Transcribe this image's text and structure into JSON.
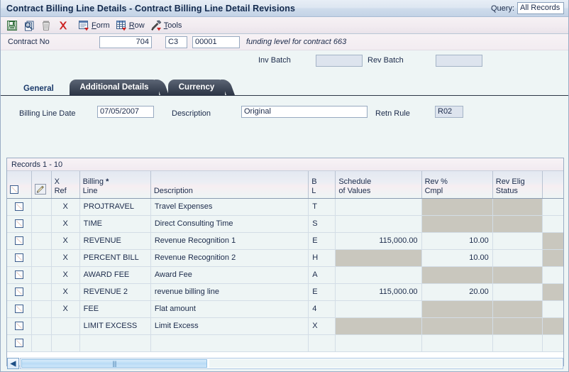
{
  "window": {
    "title": "Contract Billing Line Details - Contract Billing Line Detail Revisions",
    "query_label": "Query:",
    "query_value": "All Records"
  },
  "toolbar": {
    "items": [
      {
        "icon": "save-icon",
        "label": ""
      },
      {
        "icon": "find-icon",
        "label": ""
      },
      {
        "icon": "delete-icon",
        "label": ""
      },
      {
        "icon": "cancel-icon",
        "label": ""
      },
      {
        "icon": "form-icon",
        "label": "Form",
        "accel": "F"
      },
      {
        "icon": "row-icon",
        "label": "Row",
        "accel": "R"
      },
      {
        "icon": "tools-icon",
        "label": "Tools",
        "accel": "T"
      }
    ],
    "form_label_pre": "",
    "form_label_key": "F",
    "form_label_post": "orm",
    "row_label_pre": "",
    "row_label_key": "R",
    "row_label_post": "ow",
    "tools_label_pre": "",
    "tools_label_key": "T",
    "tools_label_post": "ools"
  },
  "header": {
    "contract_no_label": "Contract No",
    "contract_no": "704",
    "contract_type": "C3",
    "contract_seq": "00001",
    "contract_note": "funding level for contract 663",
    "inv_batch_label": "Inv Batch",
    "inv_batch": "",
    "rev_batch_label": "Rev Batch",
    "rev_batch": ""
  },
  "tabs": [
    {
      "label": "General",
      "active": true
    },
    {
      "label": "Additional Details",
      "active": false
    },
    {
      "label": "Currency",
      "active": false
    }
  ],
  "detail": {
    "billing_line_date_label": "Billing Line Date",
    "billing_line_date": "07/05/2007",
    "description_label": "Description",
    "description": "Original",
    "retn_rule_label": "Retn Rule",
    "retn_rule": "R02"
  },
  "grid": {
    "records_text": "Records  1 - 10",
    "columns": [
      {
        "name": "select",
        "l1": "",
        "l2": "",
        "required": false
      },
      {
        "name": "pencil",
        "l1": "",
        "l2": "",
        "required": false
      },
      {
        "name": "x-ref",
        "l1": "X",
        "l2": "Ref",
        "required": false
      },
      {
        "name": "billing-line",
        "l1": "Billing",
        "l2": "Line",
        "required": true
      },
      {
        "name": "description",
        "l1": "",
        "l2": "Description",
        "required": false
      },
      {
        "name": "b-l",
        "l1": "B",
        "l2": "L",
        "required": false
      },
      {
        "name": "schedule-of-values",
        "l1": "Schedule",
        "l2": "of Values",
        "required": false
      },
      {
        "name": "rev-pct-cmpl",
        "l1": "Rev %",
        "l2": "Cmpl",
        "required": false
      },
      {
        "name": "rev-elig-status",
        "l1": "Rev Elig",
        "l2": "Status",
        "required": false
      },
      {
        "name": "overflow",
        "l1": "",
        "l2": "",
        "required": false
      }
    ],
    "rows": [
      {
        "xref": "X",
        "billing_line": "PROJTRAVEL",
        "description": "Travel Expenses",
        "bl": "T",
        "schedule": "",
        "rev_pct": "",
        "rev_elig": "",
        "disabled": {
          "schedule": false,
          "rev_pct": true,
          "rev_elig": true,
          "overflow": false
        }
      },
      {
        "xref": "X",
        "billing_line": "TIME",
        "description": "Direct Consulting Time",
        "bl": "S",
        "schedule": "",
        "rev_pct": "",
        "rev_elig": "",
        "disabled": {
          "schedule": false,
          "rev_pct": true,
          "rev_elig": true,
          "overflow": false
        }
      },
      {
        "xref": "X",
        "billing_line": "REVENUE",
        "description": "Revenue Recognition 1",
        "bl": "E",
        "schedule": "115,000.00",
        "rev_pct": "10.00",
        "rev_elig": "",
        "disabled": {
          "schedule": false,
          "rev_pct": false,
          "rev_elig": false,
          "overflow": true
        }
      },
      {
        "xref": "X",
        "billing_line": "PERCENT BILL",
        "description": "Revenue Recognition 2",
        "bl": "H",
        "schedule": "",
        "rev_pct": "10.00",
        "rev_elig": "",
        "disabled": {
          "schedule": true,
          "rev_pct": false,
          "rev_elig": false,
          "overflow": true
        }
      },
      {
        "xref": "X",
        "billing_line": "AWARD FEE",
        "description": "Award Fee",
        "bl": "A",
        "schedule": "",
        "rev_pct": "",
        "rev_elig": "",
        "disabled": {
          "schedule": false,
          "rev_pct": true,
          "rev_elig": true,
          "overflow": false
        }
      },
      {
        "xref": "X",
        "billing_line": "REVENUE 2",
        "description": "revenue billing line",
        "bl": "E",
        "schedule": "115,000.00",
        "rev_pct": "20.00",
        "rev_elig": "",
        "disabled": {
          "schedule": false,
          "rev_pct": false,
          "rev_elig": false,
          "overflow": true
        }
      },
      {
        "xref": "X",
        "billing_line": "FEE",
        "description": "Flat amount",
        "bl": "4",
        "schedule": "",
        "rev_pct": "",
        "rev_elig": "",
        "disabled": {
          "schedule": false,
          "rev_pct": true,
          "rev_elig": true,
          "overflow": false
        }
      },
      {
        "xref": "",
        "billing_line": "LIMIT EXCESS",
        "description": "Limit Excess",
        "bl": "X",
        "schedule": "",
        "rev_pct": "",
        "rev_elig": "",
        "disabled": {
          "schedule": true,
          "rev_pct": true,
          "rev_elig": true,
          "overflow": true
        }
      },
      {
        "xref": "",
        "billing_line": "",
        "description": "",
        "bl": "",
        "schedule": "",
        "rev_pct": "",
        "rev_elig": "",
        "disabled": {
          "schedule": false,
          "rev_pct": false,
          "rev_elig": false,
          "overflow": false
        }
      }
    ]
  },
  "scrollbar": {
    "left_arrow": "◀",
    "grip": "||||"
  }
}
